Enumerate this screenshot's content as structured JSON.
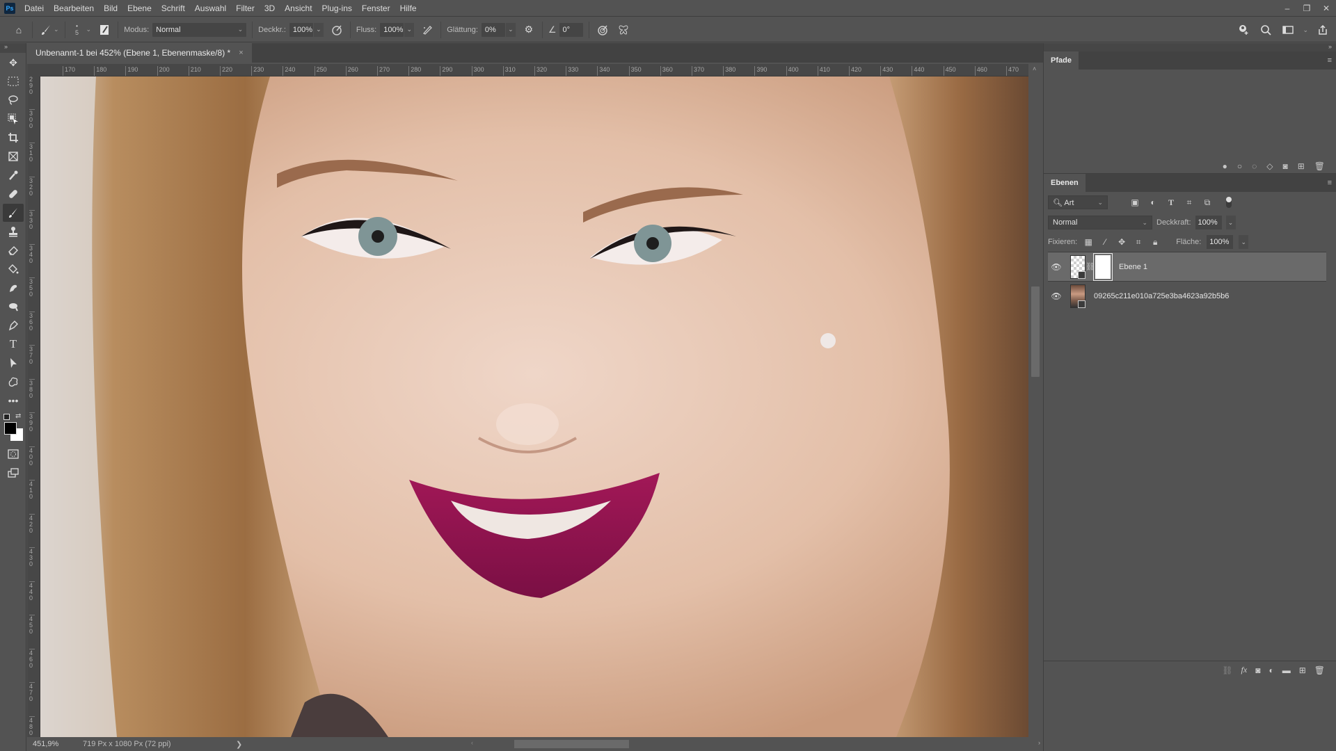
{
  "app": {
    "logo": "Ps"
  },
  "menu": [
    "Datei",
    "Bearbeiten",
    "Bild",
    "Ebene",
    "Schrift",
    "Auswahl",
    "Filter",
    "3D",
    "Ansicht",
    "Plug-ins",
    "Fenster",
    "Hilfe"
  ],
  "window_controls": {
    "minimize": "–",
    "restore": "❐",
    "close": "✕"
  },
  "options": {
    "brush_size": "5",
    "mode_label": "Modus:",
    "mode_value": "Normal",
    "opacity_label": "Deckkr.:",
    "opacity_value": "100%",
    "flow_label": "Fluss:",
    "flow_value": "100%",
    "smoothing_label": "Glättung:",
    "smoothing_value": "0%",
    "angle_value": "0°"
  },
  "document": {
    "tab_title": "Unbenannt-1 bei 452% (Ebene 1, Ebenenmaske/8) *",
    "close": "×",
    "ruler_top": [
      "170",
      "180",
      "190",
      "200",
      "210",
      "220",
      "230",
      "240",
      "250",
      "260",
      "270",
      "280",
      "290",
      "300",
      "310",
      "320",
      "330",
      "340",
      "350",
      "360",
      "370",
      "380",
      "390",
      "400",
      "410",
      "420",
      "430",
      "440",
      "450",
      "460",
      "470"
    ],
    "ruler_left": [
      "290",
      "300",
      "310",
      "320",
      "330",
      "340",
      "350",
      "360",
      "370",
      "380",
      "390",
      "400",
      "410",
      "420",
      "430",
      "440",
      "450",
      "460",
      "470",
      "480"
    ]
  },
  "status": {
    "zoom": "451,9%",
    "doc_info": "719 Px x 1080 Px (72 ppi)",
    "arrow": "❯"
  },
  "panels": {
    "collapse": "»",
    "paths": {
      "tab": "Pfade"
    },
    "layers": {
      "tab": "Ebenen",
      "filter_kind": "Art",
      "blend_mode": "Normal",
      "opacity_label": "Deckkraft:",
      "opacity_value": "100%",
      "lock_label": "Fixieren:",
      "fill_label": "Fläche:",
      "fill_value": "100%",
      "items": [
        {
          "name": "Ebene 1",
          "visible": true,
          "selected": true,
          "has_mask": true
        },
        {
          "name": "09265c211e010a725e3ba4623a92b5b6",
          "visible": true,
          "selected": false,
          "has_mask": false
        }
      ]
    }
  },
  "toolbar": {
    "tools": [
      "move",
      "rect-marquee",
      "lasso",
      "object-select",
      "crop",
      "frame",
      "eyedropper",
      "healing",
      "brush",
      "clone-stamp",
      "eraser",
      "paint-bucket",
      "smudge",
      "dodge",
      "pen",
      "type",
      "path-select",
      "custom-shape",
      "more",
      "",
      "",
      ""
    ],
    "active_tool": "brush",
    "foreground_color": "#000000",
    "background_color": "#ffffff"
  }
}
